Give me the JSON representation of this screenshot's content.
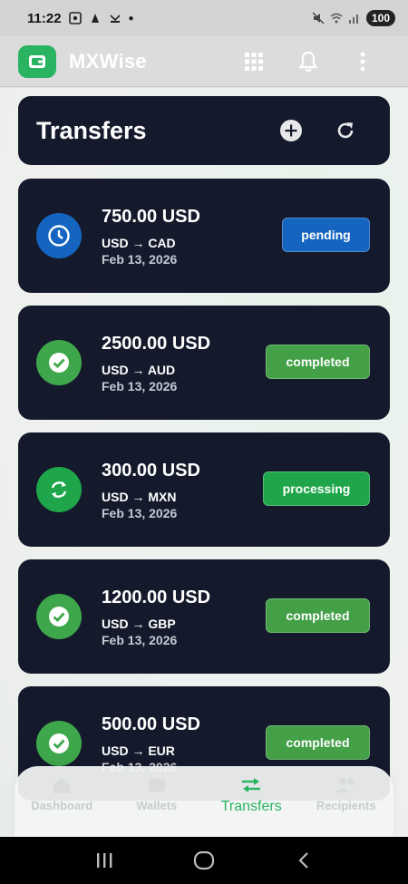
{
  "status_bar": {
    "time": "11:22",
    "battery": "100"
  },
  "app_bar": {
    "title": "MXWise"
  },
  "header": {
    "title": "Transfers"
  },
  "transfers": [
    {
      "amount": "750.00 USD",
      "route": "USD → CAD",
      "date": "Feb 13, 2026",
      "status": "pending",
      "status_icon": "clock-icon",
      "status_color": "#1565c0",
      "badge_color": "#1565c0"
    },
    {
      "amount": "2500.00 USD",
      "route": "USD → AUD",
      "date": "Feb 13, 2026",
      "status": "completed",
      "status_icon": "check-icon",
      "status_color": "#3fa74b",
      "badge_color": "#43a047"
    },
    {
      "amount": "300.00 USD",
      "route": "USD → MXN",
      "date": "Feb 13, 2026",
      "status": "processing",
      "status_icon": "sync-icon",
      "status_color": "#1fa64a",
      "badge_color": "#1fa64a"
    },
    {
      "amount": "1200.00 USD",
      "route": "USD → GBP",
      "date": "Feb 13, 2026",
      "status": "completed",
      "status_icon": "check-icon",
      "status_color": "#3fa74b",
      "badge_color": "#43a047"
    },
    {
      "amount": "500.00 USD",
      "route": "USD → EUR",
      "date": "Feb 13, 2026",
      "status": "completed",
      "status_icon": "check-icon",
      "status_color": "#3fa74b",
      "badge_color": "#43a047"
    }
  ],
  "bottom_nav": {
    "items": [
      {
        "label": "Dashboard",
        "icon": "home-icon"
      },
      {
        "label": "Wallets",
        "icon": "wallet-icon"
      },
      {
        "label": "Transfers",
        "icon": "swap-icon",
        "active": true
      },
      {
        "label": "Recipients",
        "icon": "people-icon"
      }
    ]
  },
  "colors": {
    "accent": "#2ab462",
    "card_bg": "#141a2c"
  }
}
